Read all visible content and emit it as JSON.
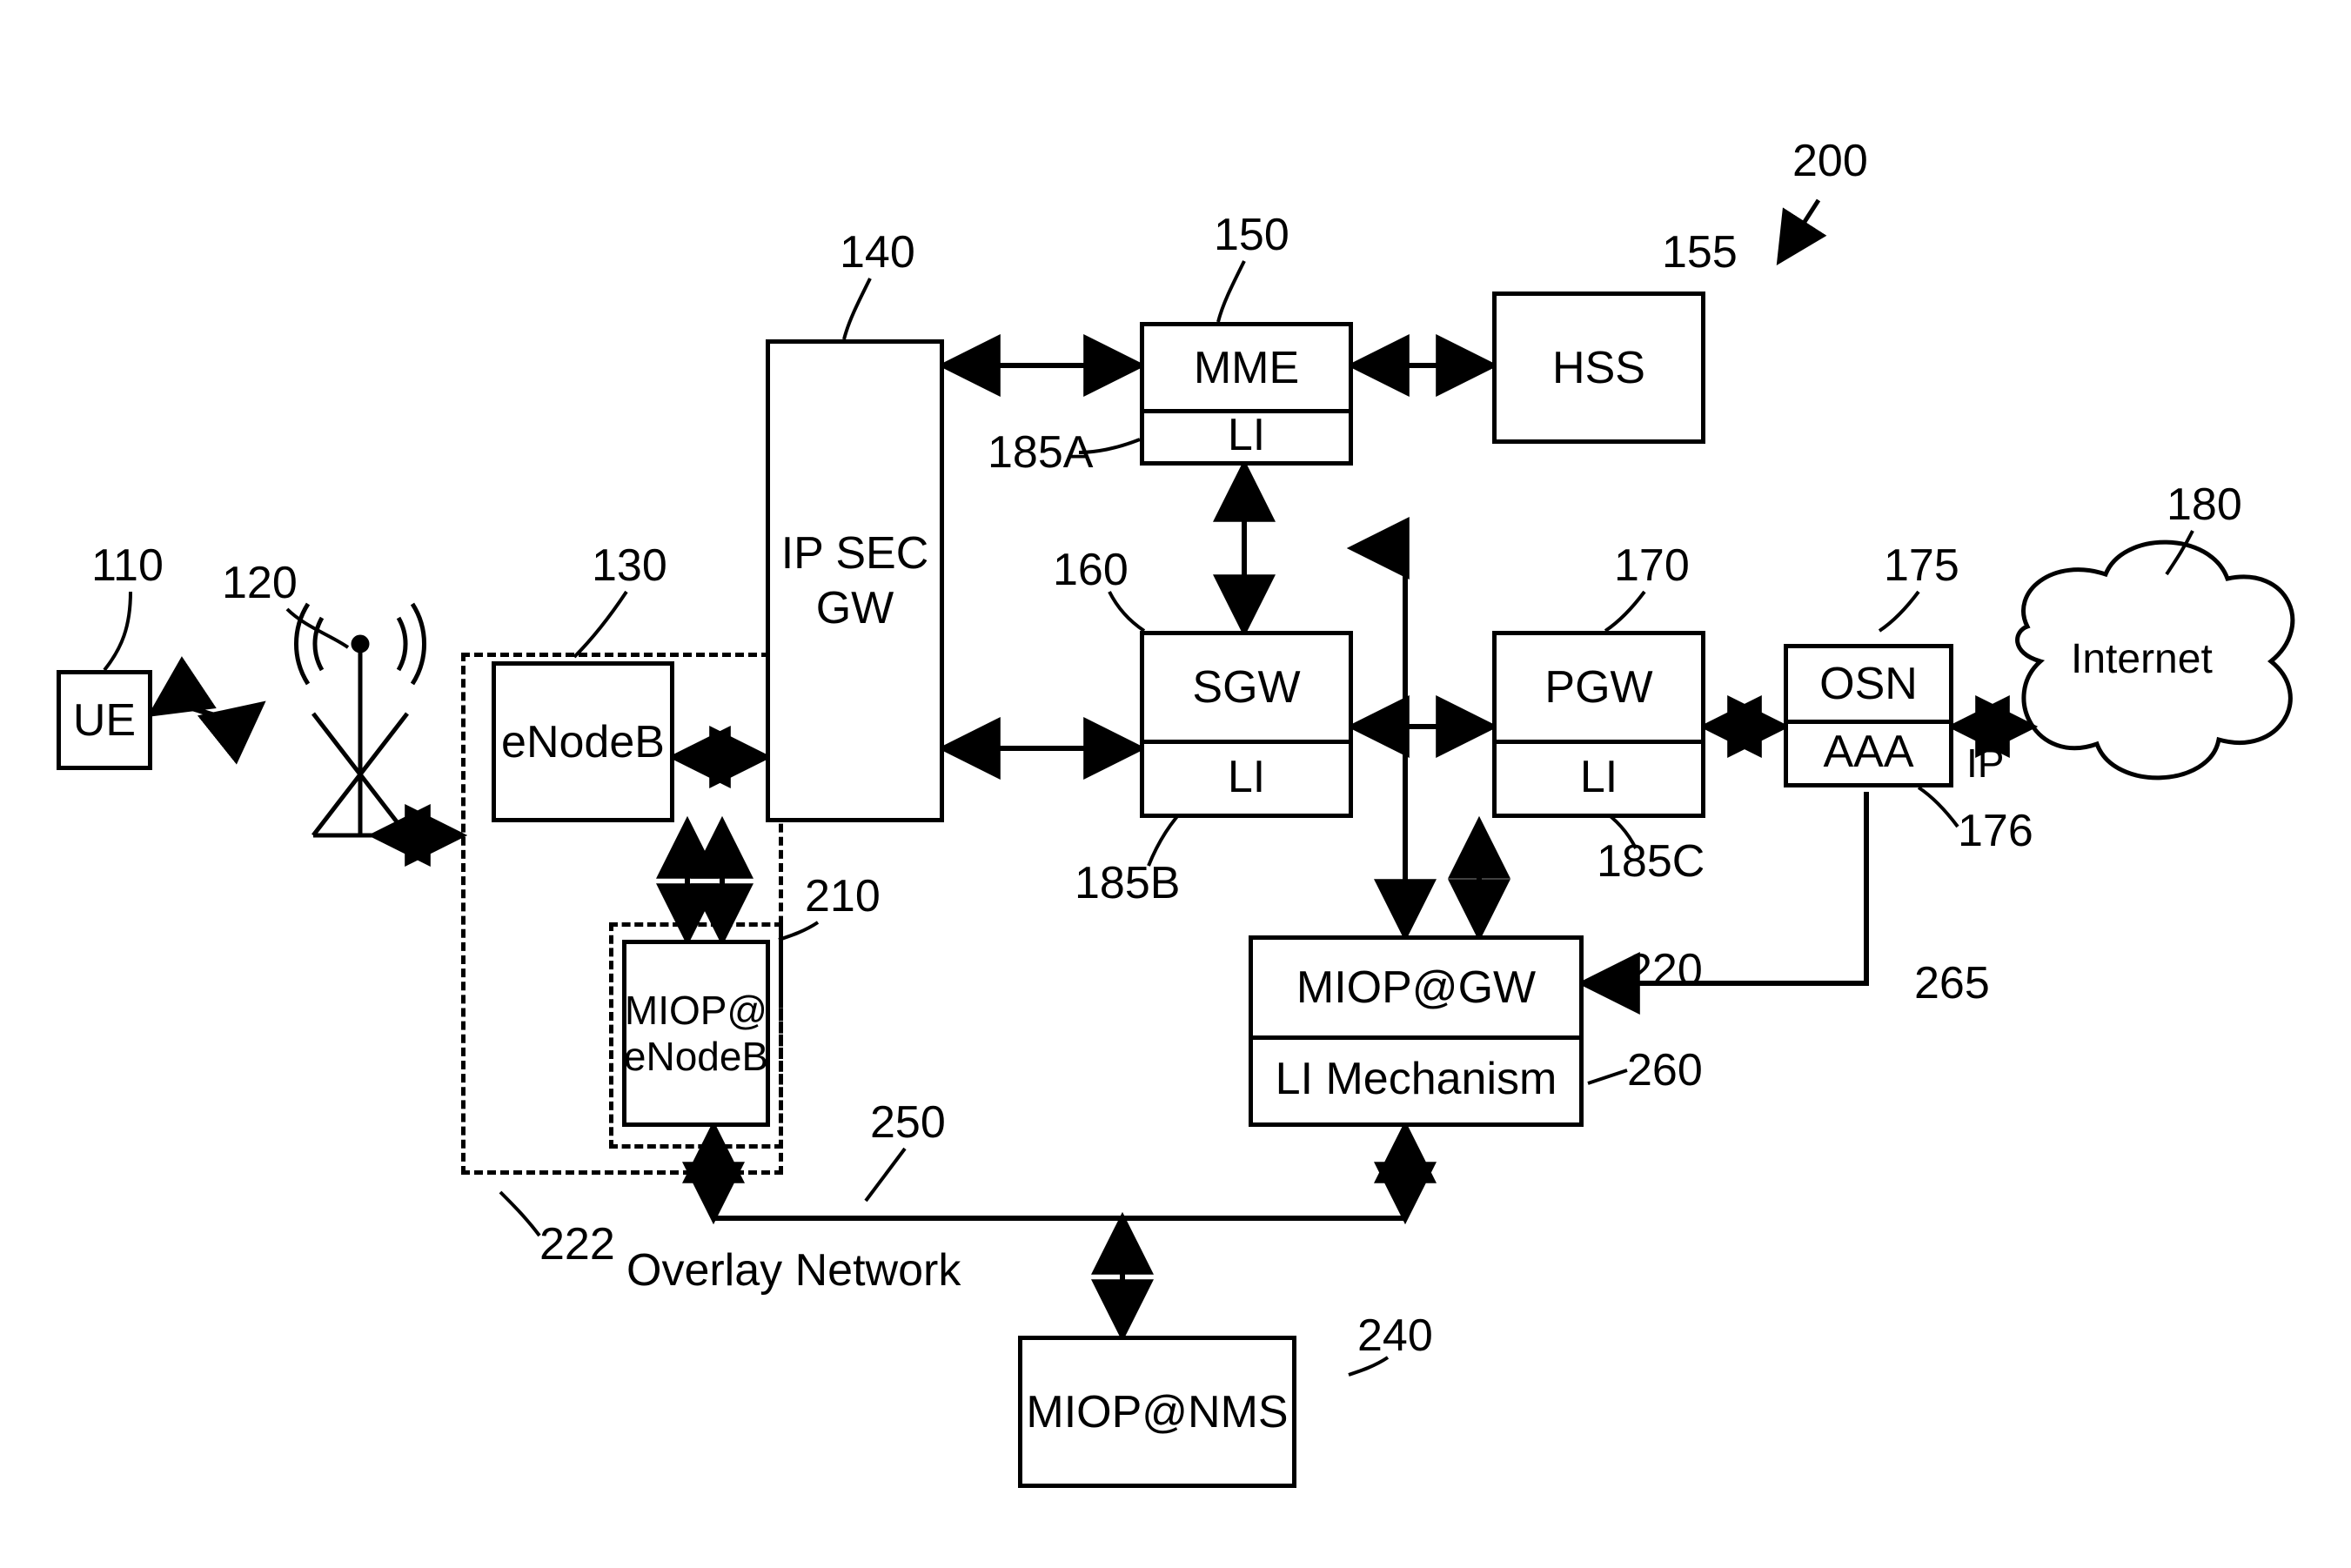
{
  "figure_ref": "200",
  "nodes": {
    "ue": {
      "label": "UE",
      "ref": "110"
    },
    "antenna": {
      "ref": "120"
    },
    "enodeb": {
      "label": "eNodeB",
      "ref": "130"
    },
    "enodeb_group": {
      "ref": "222"
    },
    "ipsecgw": {
      "label": "IP SEC\nGW",
      "ref": "140"
    },
    "mme": {
      "label": "MME",
      "li": "LI",
      "ref": "150",
      "li_ref": "185A"
    },
    "hss": {
      "label": "HSS",
      "ref": "155"
    },
    "sgw": {
      "label": "SGW",
      "li": "LI",
      "ref": "160",
      "li_ref": "185B"
    },
    "pgw": {
      "label": "PGW",
      "li": "LI",
      "ref": "170",
      "li_ref": "185C"
    },
    "osn": {
      "top": "OSN",
      "bottom": "AAA",
      "ref": "175",
      "aaa_ref": "176"
    },
    "internet": {
      "label": "Internet",
      "ref": "180",
      "ip": "IP"
    },
    "miop_enb": {
      "label": "MIOP@\neNodeB",
      "ref": "210"
    },
    "miop_gw": {
      "top": "MIOP@GW",
      "bottom": "LI Mechanism",
      "ref": "220",
      "li_ref": "260"
    },
    "aaa_link": {
      "ref": "265"
    },
    "overlay": {
      "label": "Overlay Network",
      "ref": "250"
    },
    "miop_nms": {
      "label": "MIOP@NMS",
      "ref": "240"
    }
  }
}
